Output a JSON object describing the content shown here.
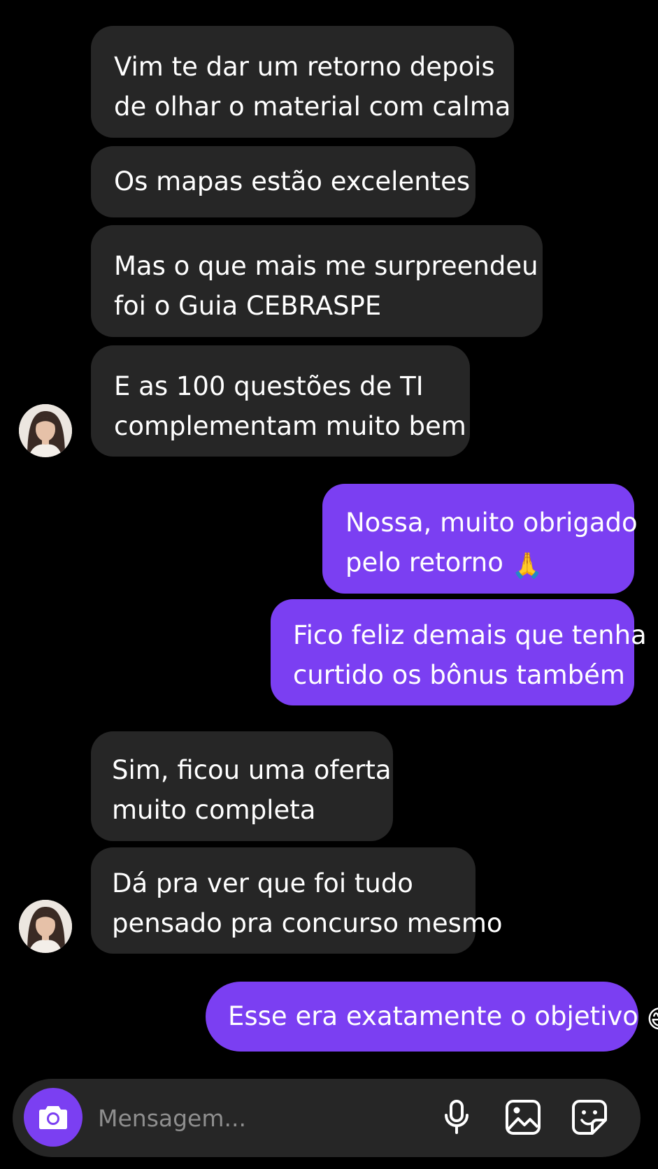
{
  "conversation": {
    "messages": [
      {
        "sender": "contact",
        "lines": [
          "Vim te dar um retorno depois",
          "de olhar o material com calma"
        ]
      },
      {
        "sender": "contact",
        "lines": [
          "Os mapas estão excelentes"
        ]
      },
      {
        "sender": "contact",
        "lines": [
          "Mas o que mais me surpreendeu",
          "foi o Guia CEBRASPE"
        ]
      },
      {
        "sender": "contact",
        "lines": [
          "E as 100 questões de TI",
          "complementam muito bem"
        ]
      },
      {
        "sender": "me",
        "lines": [
          "Nossa, muito obrigado",
          "pelo retorno"
        ],
        "emoji": "🙏"
      },
      {
        "sender": "me",
        "lines": [
          "Fico feliz demais que tenha",
          "curtido os bônus também"
        ]
      },
      {
        "sender": "contact",
        "lines": [
          "Sim, ficou uma oferta",
          "muito completa"
        ]
      },
      {
        "sender": "contact",
        "lines": [
          "Dá pra ver que foi tudo",
          "pensado pra concurso mesmo"
        ]
      },
      {
        "sender": "me",
        "lines": [
          "Esse era exatamente o objetivo"
        ],
        "emoji": "😄"
      }
    ]
  },
  "composer": {
    "placeholder": "Mensagem...",
    "value": "",
    "icons": [
      "camera-icon",
      "microphone-icon",
      "gallery-icon",
      "sticker-icon"
    ]
  },
  "colors": {
    "background": "#000000",
    "incoming_bubble": "#262626",
    "outgoing_bubble": "#7b3ff2",
    "composer": "#262626",
    "accent": "#7b3ff2"
  }
}
